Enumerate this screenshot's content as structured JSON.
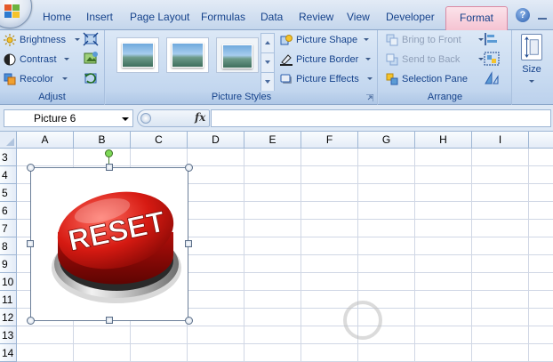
{
  "tabs": [
    "Home",
    "Insert",
    "Page Layout",
    "Formulas",
    "Data",
    "Review",
    "View",
    "Developer",
    "Format"
  ],
  "active_tab": "Format",
  "help_label": "?",
  "groups": {
    "adjust": {
      "label": "Adjust",
      "brightness": "Brightness",
      "contrast": "Contrast",
      "recolor": "Recolor"
    },
    "picture_styles": {
      "label": "Picture Styles",
      "picture_shape": "Picture Shape",
      "picture_border": "Picture Border",
      "picture_effects": "Picture Effects"
    },
    "arrange": {
      "label": "Arrange",
      "bring_to_front": "Bring to Front",
      "send_to_back": "Send to Back",
      "selection_pane": "Selection Pane"
    },
    "size": {
      "label": "Size"
    }
  },
  "formula_bar": {
    "name_box": "Picture 6",
    "fx": "fx",
    "formula": ""
  },
  "columns": [
    "A",
    "B",
    "C",
    "D",
    "E",
    "F",
    "G",
    "H",
    "I"
  ],
  "rows": [
    "3",
    "4",
    "5",
    "6",
    "7",
    "8",
    "9",
    "10",
    "11",
    "12",
    "13",
    "14"
  ],
  "picture": {
    "text": "RESET",
    "color": "#d42020"
  },
  "colors": {
    "ribbon_accent": "#15428b",
    "format_tab": "#f5c3d2"
  }
}
